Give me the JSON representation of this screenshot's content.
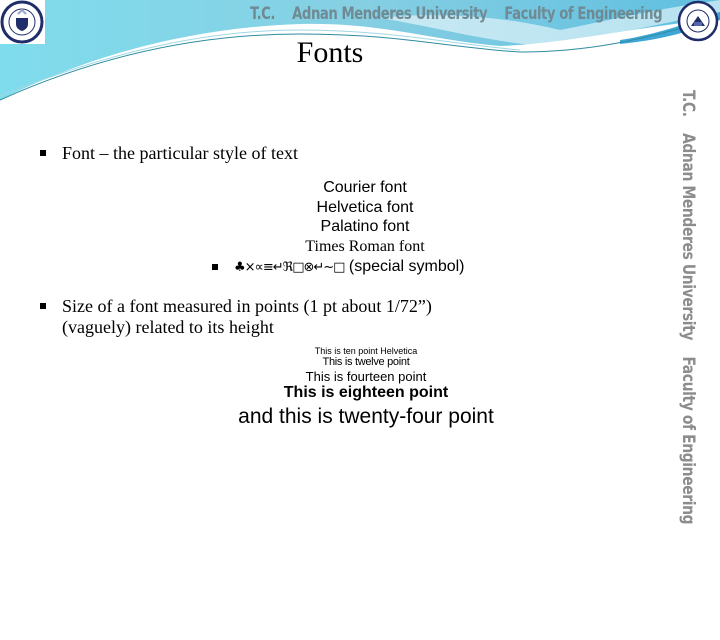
{
  "header": {
    "institution": [
      "T.C.",
      "Adnan Menderes University",
      "Faculty of Engineering"
    ],
    "colors": {
      "wave_light": "#8fd9e8",
      "wave_mid": "#6cc4dc",
      "wave_dark": "#4aa8c6",
      "line": "#2f8da0",
      "title_text": "#6f8a93",
      "logo_navy": "#1f2d6b"
    },
    "logo_left": "university-seal-icon",
    "logo_right": "faculty-seal-icon"
  },
  "side_strip": [
    "T.C.",
    "Adnan Menderes University",
    "Faculty of Engineering"
  ],
  "slide": {
    "title": "Fonts",
    "bullet1": "Font – the particular style of text",
    "font_examples": [
      "Courier font",
      "Helvetica font",
      "Palatino font",
      "Times Roman font"
    ],
    "special_symbols": "♣×∝≡↵ℜ□⊗↵~□",
    "special_label": "(special symbol)",
    "bullet2_line1": "Size of a font measured in points (1 pt about 1/72”)",
    "bullet2_line2": "(vaguely) related to its height",
    "size_examples": [
      "This is ten point Helvetica",
      "This is twelve point",
      "This is fourteen point",
      "This is eighteen point",
      "and this is twenty-four point"
    ]
  }
}
